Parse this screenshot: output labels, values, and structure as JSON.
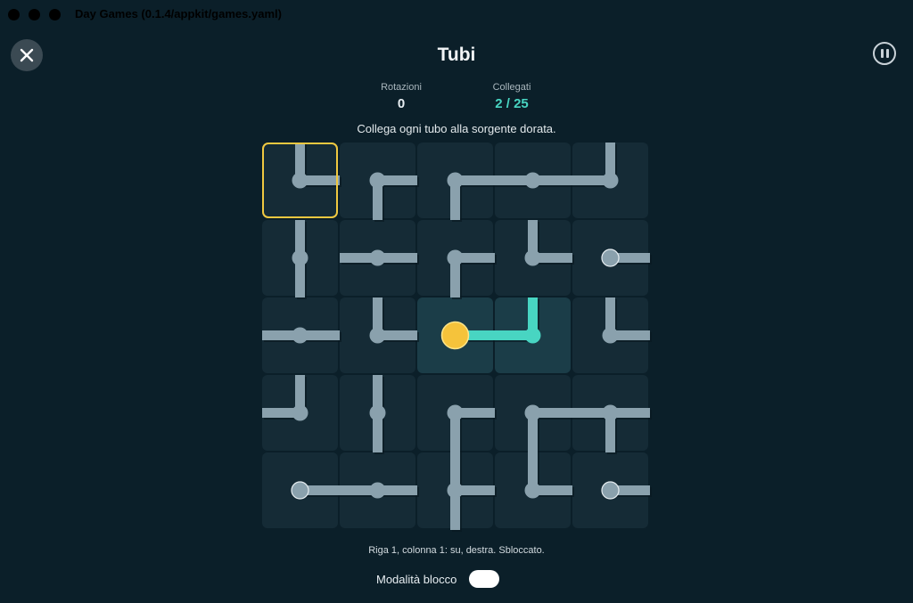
{
  "window": {
    "title": "Day Games (0.1.4/appkit/games.yaml)"
  },
  "header": {
    "title": "Tubi",
    "close_icon": "close-icon",
    "pause_icon": "pause-icon"
  },
  "stats": {
    "rotations_label": "Rotazioni",
    "rotations_value": "0",
    "connected_label": "Collegati",
    "connected_value": "2 / 25"
  },
  "instruction": "Collega ogni tubo alla sorgente dorata.",
  "status_line": "Riga 1, colonna 1: su, destra. Sbloccato.",
  "lock_mode": {
    "label": "Modalità blocco",
    "enabled": false
  },
  "colors": {
    "background": "#0b1f29",
    "tile": "#152b36",
    "tile_connected": "#1b3d48",
    "pipe": "#8aa1ad",
    "pipe_connected": "#48d5c2",
    "source": "#f5c33b",
    "selection": "#f0c840"
  },
  "grid": {
    "rows": 5,
    "cols": 5,
    "selected": [
      0,
      0
    ],
    "source": [
      2,
      2
    ],
    "tiles": [
      [
        {
          "pipes": [
            "up",
            "right"
          ],
          "connected": false,
          "endpoint": false
        },
        {
          "pipes": [
            "down",
            "right"
          ],
          "connected": false,
          "endpoint": false
        },
        {
          "pipes": [
            "right",
            "down"
          ],
          "connected": false,
          "endpoint": false
        },
        {
          "pipes": [
            "left",
            "right"
          ],
          "connected": false,
          "endpoint": false
        },
        {
          "pipes": [
            "left",
            "up"
          ],
          "connected": false,
          "endpoint": false
        }
      ],
      [
        {
          "pipes": [
            "up",
            "down"
          ],
          "connected": false,
          "endpoint": false
        },
        {
          "pipes": [
            "left",
            "right"
          ],
          "connected": false,
          "endpoint": false
        },
        {
          "pipes": [
            "right",
            "down"
          ],
          "connected": false,
          "endpoint": false
        },
        {
          "pipes": [
            "up",
            "right"
          ],
          "connected": false,
          "endpoint": false
        },
        {
          "pipes": [
            "right"
          ],
          "connected": false,
          "endpoint": true
        }
      ],
      [
        {
          "pipes": [
            "left",
            "right"
          ],
          "connected": false,
          "endpoint": false
        },
        {
          "pipes": [
            "up",
            "right"
          ],
          "connected": false,
          "endpoint": false
        },
        {
          "pipes": [
            "right"
          ],
          "connected": true,
          "endpoint": false
        },
        {
          "pipes": [
            "left",
            "up"
          ],
          "connected": true,
          "endpoint": false
        },
        {
          "pipes": [
            "up",
            "right"
          ],
          "connected": false,
          "endpoint": false
        }
      ],
      [
        {
          "pipes": [
            "up",
            "left"
          ],
          "connected": false,
          "endpoint": false
        },
        {
          "pipes": [
            "up",
            "down"
          ],
          "connected": false,
          "endpoint": false
        },
        {
          "pipes": [
            "right",
            "down"
          ],
          "connected": false,
          "endpoint": false
        },
        {
          "pipes": [
            "right",
            "down"
          ],
          "connected": false,
          "endpoint": false
        },
        {
          "pipes": [
            "left",
            "right",
            "down"
          ],
          "connected": false,
          "endpoint": false
        }
      ],
      [
        {
          "pipes": [
            "right"
          ],
          "connected": false,
          "endpoint": true
        },
        {
          "pipes": [
            "left",
            "right"
          ],
          "connected": false,
          "endpoint": false
        },
        {
          "pipes": [
            "up",
            "down",
            "right"
          ],
          "connected": false,
          "endpoint": false
        },
        {
          "pipes": [
            "up",
            "right"
          ],
          "connected": false,
          "endpoint": false
        },
        {
          "pipes": [
            "right"
          ],
          "connected": false,
          "endpoint": true
        }
      ]
    ]
  }
}
